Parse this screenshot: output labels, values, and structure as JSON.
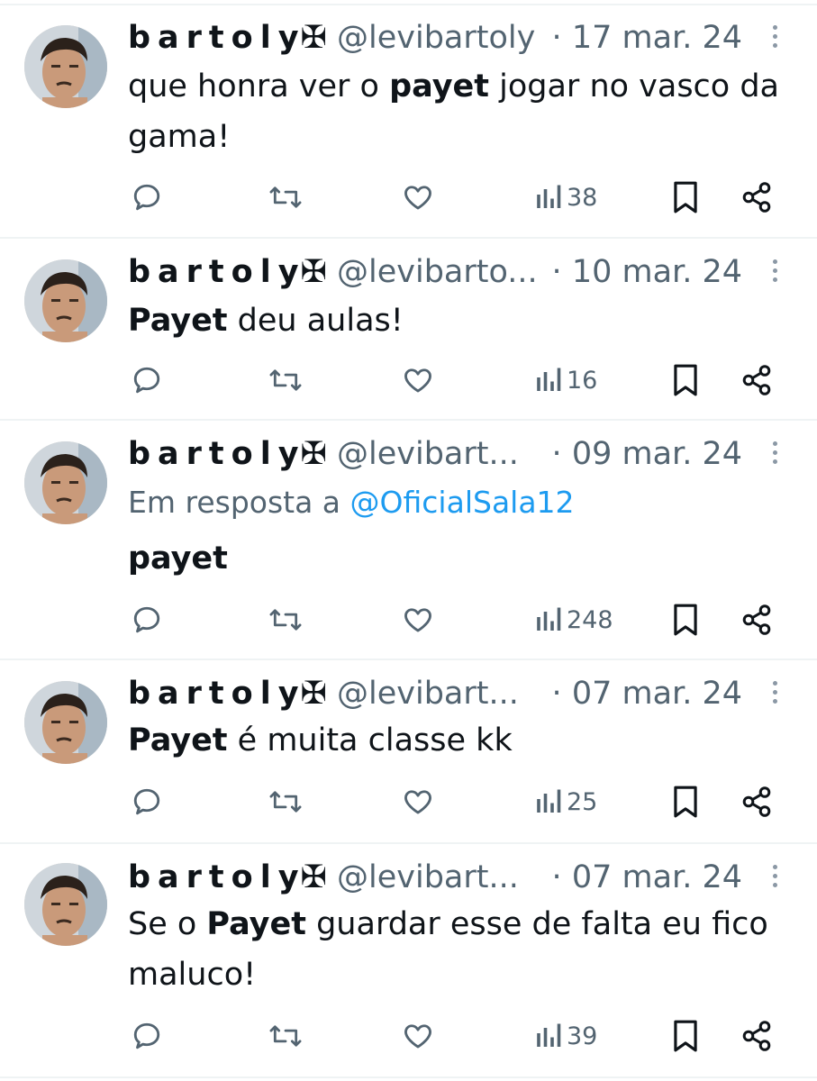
{
  "tweets": [
    {
      "name": "bartoly",
      "name_icon": "cross-of-vasco-glyph",
      "handle": "@levibartoly",
      "date": "17 mar. 24",
      "text_lines": [
        {
          "before": "que honra ver o ",
          "bold": "payet",
          "after": " jogar no vasco da"
        },
        {
          "before": "gama!",
          "bold": "",
          "after": ""
        }
      ],
      "views": "38"
    },
    {
      "name": "bartoly",
      "name_icon": "cross-of-vasco-glyph",
      "handle": "@levibarto...",
      "date": "10 mar. 24",
      "text_lines": [
        {
          "before": "",
          "bold": "Payet",
          "after": " deu aulas!"
        }
      ],
      "views": "16"
    },
    {
      "name": "bartoly",
      "name_icon": "cross-of-vasco-glyph",
      "handle": "@levibart...",
      "date": "09 mar. 24",
      "reply_prefix": "Em resposta a ",
      "reply_mention": "@OficialSala12",
      "text_lines": [
        {
          "before": "",
          "bold": "payet",
          "after": ""
        }
      ],
      "views": "248"
    },
    {
      "name": "bartoly",
      "name_icon": "cross-of-vasco-glyph",
      "handle": "@levibart...",
      "date": "07 mar. 24",
      "text_lines": [
        {
          "before": "",
          "bold": "Payet",
          "after": " é muita classe kk"
        }
      ],
      "views": "25"
    },
    {
      "name": "bartoly",
      "name_icon": "cross-of-vasco-glyph",
      "handle": "@levibart...",
      "date": "07 mar. 24",
      "text_lines": [
        {
          "before": "Se o ",
          "bold": "Payet",
          "after": " guardar esse de falta eu fico"
        },
        {
          "before": "maluco!",
          "bold": "",
          "after": ""
        }
      ],
      "views": "39"
    }
  ],
  "icons": [
    "reply-icon",
    "retweet-icon",
    "like-icon",
    "views-icon",
    "bookmark-icon",
    "share-icon",
    "more-icon"
  ],
  "colors": {
    "text": "#0f1419",
    "secondary": "#536471",
    "link": "#1d9bf0",
    "divider": "#eff3f4"
  }
}
